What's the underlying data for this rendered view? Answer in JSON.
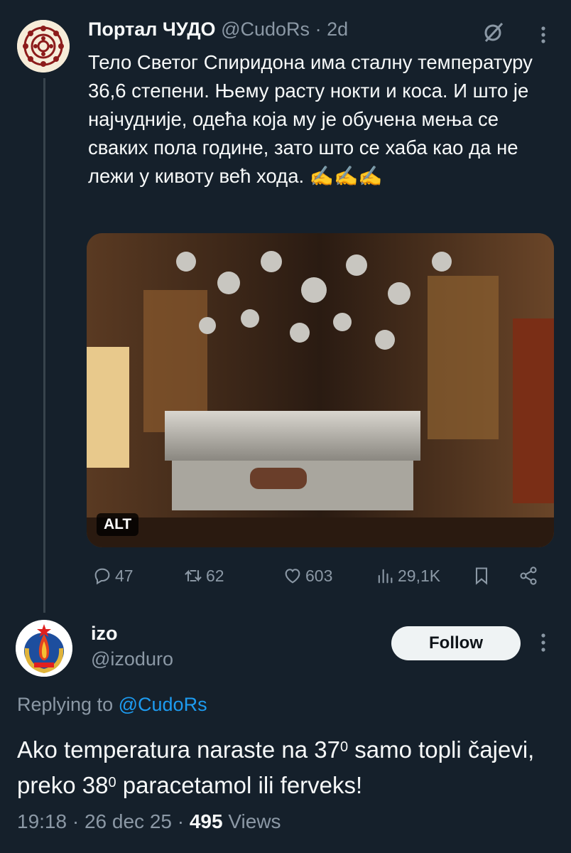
{
  "quoted_tweet": {
    "author_name": "Портал ЧУДО",
    "author_handle": "@CudoRs",
    "separator": "·",
    "time_ago": "2d",
    "text": "Тело Светог Спиридона има сталну температуру 36,6 степени. Њему расту нокти и коса. И што је најчудније, одећа која му је обучена мења се сваких пола године, зато што се хаба као да не лежи у кивоту већ хода. ✍️✍️✍️",
    "media_alt_badge": "ALT",
    "stats": {
      "replies": "47",
      "reposts": "62",
      "likes": "603",
      "views": "29,1K"
    }
  },
  "reply": {
    "author_name": "izo",
    "author_handle": "@izoduro",
    "follow_label": "Follow",
    "replying_prefix": "Replying to",
    "replying_to": "@CudoRs",
    "text_part1": "Ako temperatura naraste na 37",
    "degree1": "0",
    "text_part2": " samo topli čajevi, preko 38",
    "degree2": "0",
    "text_part3": " paracetamol ili ferveks!",
    "time": "19:18",
    "separator": "·",
    "date": "26 dec 25",
    "views_count": "495",
    "views_label": "Views"
  },
  "icons": {
    "reply": "reply-icon",
    "repost": "repost-icon",
    "like": "heart-icon",
    "views": "views-icon",
    "bookmark": "bookmark-icon",
    "share": "share-icon",
    "grok": "grok-icon",
    "more": "more-icon"
  },
  "colors": {
    "background": "#15202b",
    "text": "#f7f9f9",
    "secondary_text": "#8b98a5",
    "link": "#1d9bf0",
    "follow_button_bg": "#eff3f4"
  }
}
